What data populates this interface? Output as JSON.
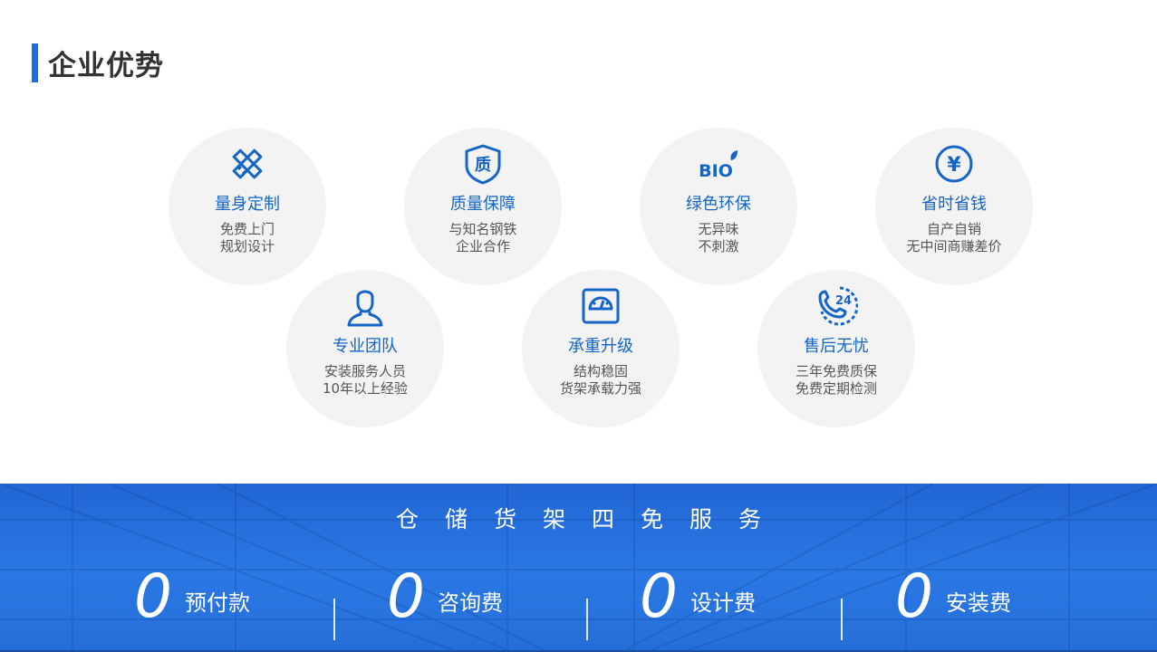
{
  "section": {
    "title": "企业优势"
  },
  "advantages": [
    {
      "icon": "ruler-pencil-icon",
      "title": "量身定制",
      "line1": "免费上门",
      "line2": "规划设计"
    },
    {
      "icon": "quality-shield-icon",
      "title": "质量保障",
      "line1": "与知名钢铁",
      "line2": "企业合作",
      "glyph": "质"
    },
    {
      "icon": "bio-leaf-icon",
      "title": "绿色环保",
      "line1": "无异味",
      "line2": "不刺激",
      "glyph": "BIO"
    },
    {
      "icon": "yuan-coin-icon",
      "title": "省时省钱",
      "line1": "自产自销",
      "line2": "无中间商赚差价",
      "glyph": "¥"
    },
    {
      "icon": "person-icon",
      "title": "专业团队",
      "line1": "安装服务人员",
      "line2": "10年以上经验"
    },
    {
      "icon": "scale-gauge-icon",
      "title": "承重升级",
      "line1": "结构稳固",
      "line2": "货架承载力强"
    },
    {
      "icon": "phone-24h-icon",
      "title": "售后无忧",
      "line1": "三年免费质保",
      "line2": "免费定期检测",
      "glyph": "24"
    }
  ],
  "banner": {
    "heading": "仓储货架四免服务",
    "items": [
      {
        "number": "0",
        "label": "预付款"
      },
      {
        "number": "0",
        "label": "咨询费"
      },
      {
        "number": "0",
        "label": "设计费"
      },
      {
        "number": "0",
        "label": "安装费"
      }
    ]
  },
  "colors": {
    "accent": "#1a6fe0",
    "title_blue": "#1565c8",
    "banner_blue": "#2a78e4",
    "circle_bg": "#f3f3f3"
  }
}
